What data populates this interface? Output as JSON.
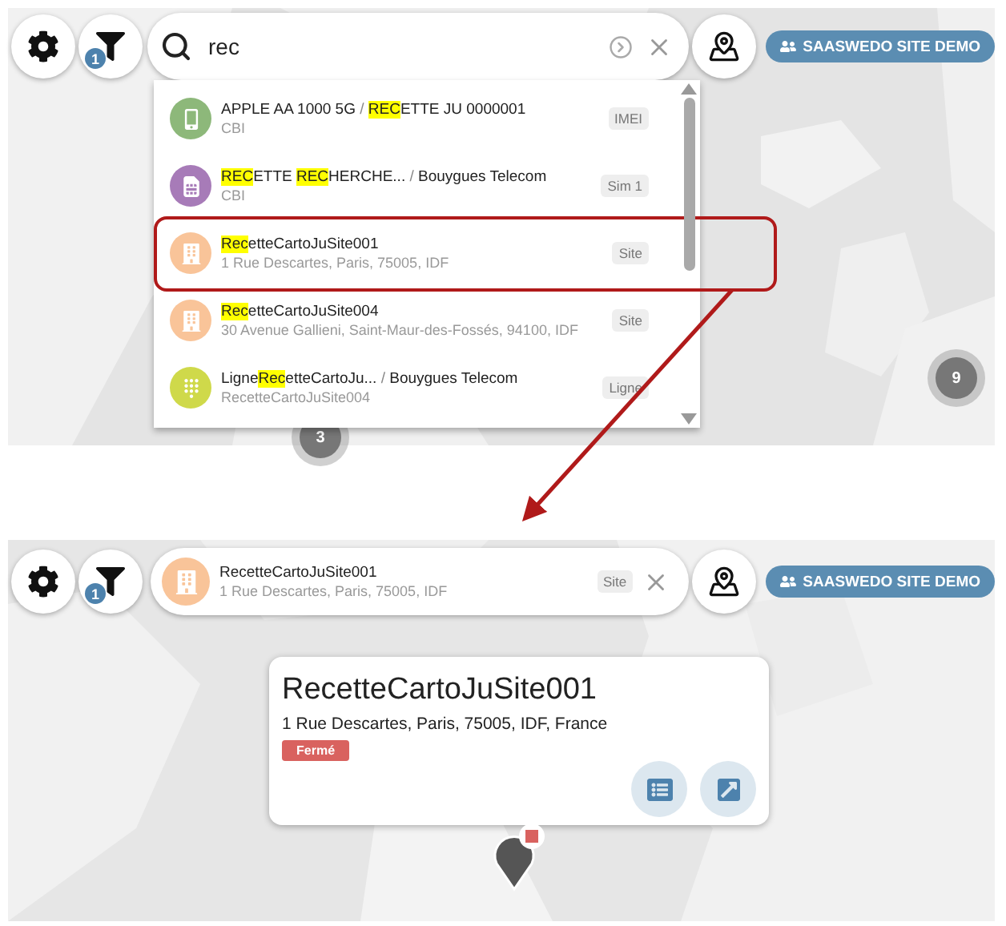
{
  "before": {
    "toolbar": {
      "filter_badge": "1",
      "search": {
        "value": "rec"
      },
      "user_button": "SAASWEDO SITE DEMO"
    },
    "results": [
      {
        "kind": "device",
        "color": "#8db87a",
        "title": [
          {
            "text": "APPLE AA 1000 5G",
            "kind": "plain"
          },
          {
            "text": " / ",
            "kind": "separator"
          },
          {
            "text": "REC",
            "kind": "highlight"
          },
          {
            "text": "ETTE JU 0000001",
            "kind": "plain"
          }
        ],
        "subtitle": "CBI",
        "tag": "IMEI",
        "framed": false
      },
      {
        "kind": "sim",
        "color": "#a77bb8",
        "title": [
          {
            "text": "REC",
            "kind": "highlight"
          },
          {
            "text": "ETTE ",
            "kind": "plain"
          },
          {
            "text": "REC",
            "kind": "highlight"
          },
          {
            "text": "HERCHE...",
            "kind": "plain"
          },
          {
            "text": " / ",
            "kind": "separator"
          },
          {
            "text": "Bouygues Telecom",
            "kind": "plain"
          }
        ],
        "subtitle": "CBI",
        "tag": "Sim 1",
        "framed": false
      },
      {
        "kind": "building",
        "color": "#f9c499",
        "title": [
          {
            "text": "Rec",
            "kind": "highlight"
          },
          {
            "text": "etteCartoJuSite001",
            "kind": "plain"
          }
        ],
        "subtitle": "1 Rue Descartes, Paris, 75005, IDF",
        "tag": "Site",
        "framed": true
      },
      {
        "kind": "building",
        "color": "#f9c499",
        "title": [
          {
            "text": "Rec",
            "kind": "highlight"
          },
          {
            "text": "etteCartoJuSite004",
            "kind": "plain"
          }
        ],
        "subtitle": "30 Avenue Gallieni, Saint-Maur-des-Fossés, 94100, IDF",
        "tag": "Site",
        "framed": false
      },
      {
        "kind": "line",
        "color": "#cfd94a",
        "title": [
          {
            "text": "Ligne",
            "kind": "plain"
          },
          {
            "text": "Rec",
            "kind": "highlight"
          },
          {
            "text": "etteCartoJu...",
            "kind": "plain"
          },
          {
            "text": " / ",
            "kind": "separator"
          },
          {
            "text": "Bouygues Telecom",
            "kind": "plain"
          }
        ],
        "subtitle": "RecetteCartoJuSite004",
        "tag": "Ligne",
        "framed": false
      }
    ],
    "clusters": [
      {
        "count": "3"
      },
      {
        "count": "9"
      }
    ]
  },
  "after": {
    "toolbar": {
      "filter_badge": "1",
      "selected": {
        "kind": "building",
        "color": "#f9c499",
        "title": "RecetteCartoJuSite001",
        "subtitle": "1 Rue Descartes, Paris, 75005, IDF",
        "tag": "Site"
      },
      "user_button": "SAASWEDO SITE DEMO"
    },
    "popup": {
      "title": "RecetteCartoJuSite001",
      "address": "1 Rue Descartes, Paris, 75005, IDF, France",
      "status": "Fermé"
    }
  }
}
